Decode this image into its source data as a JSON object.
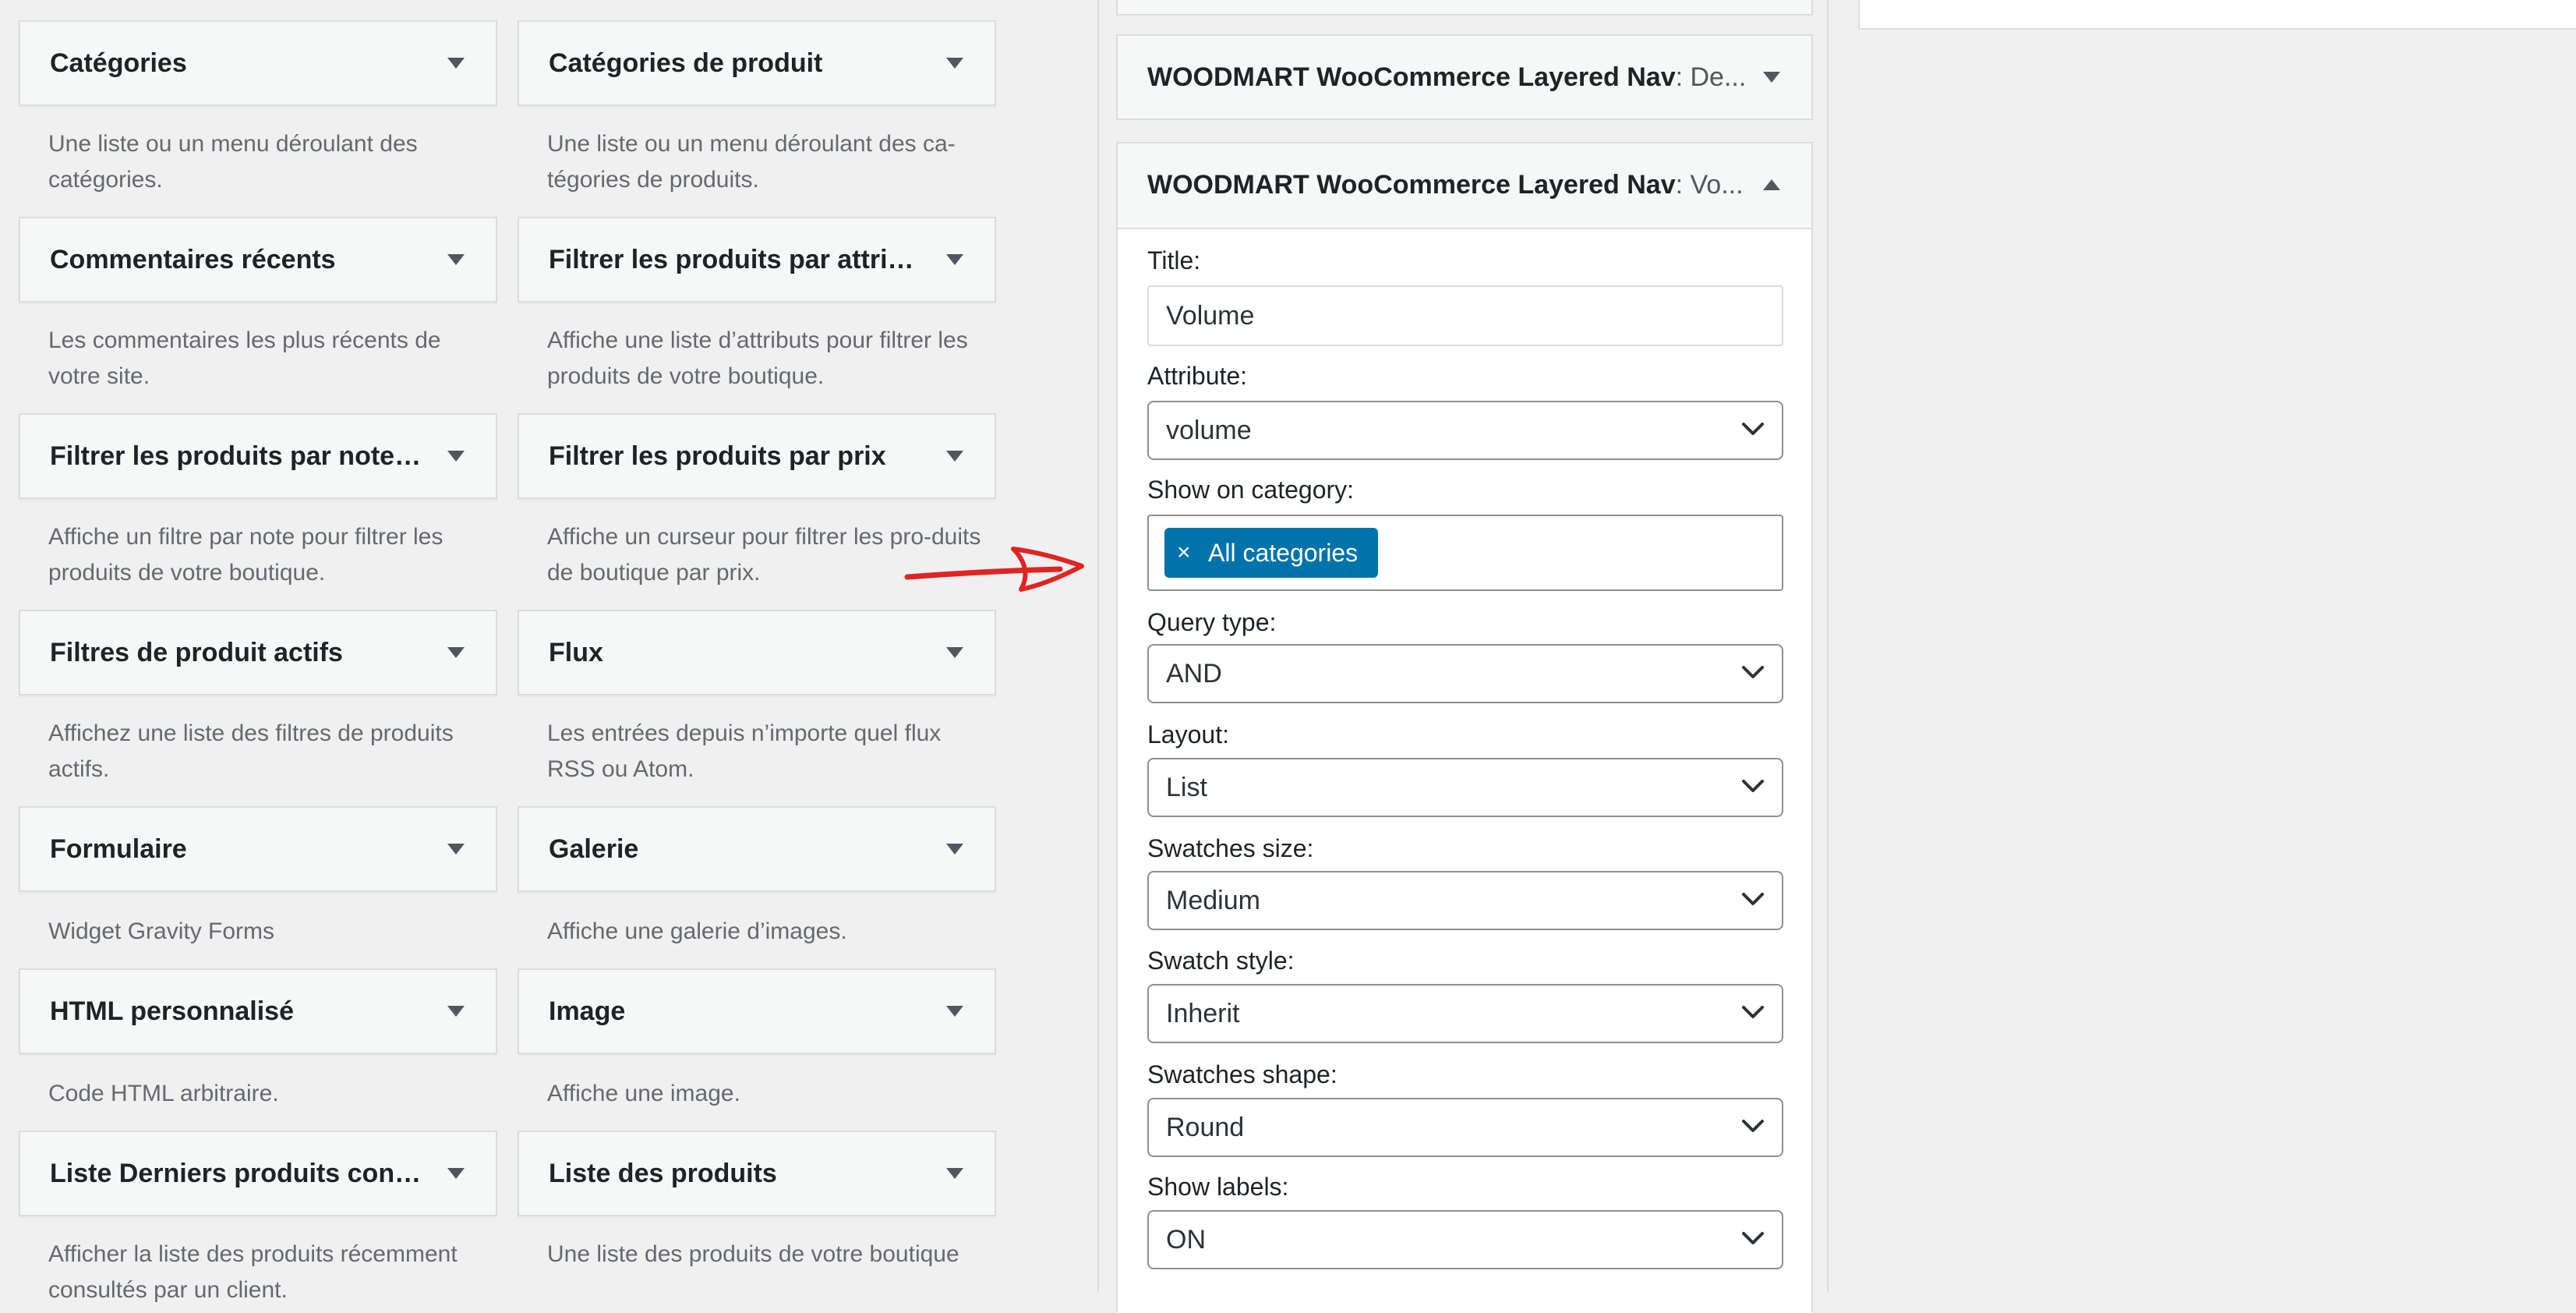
{
  "available_widgets": [
    {
      "title": "Catégories",
      "desc": "Une liste ou un menu déroulant des catégories."
    },
    {
      "title": "Catégories de produit",
      "desc": "Une liste ou un menu déroulant des ca-tégories de produits."
    },
    {
      "title": "Commentaires récents",
      "desc": "Les commentaires les plus récents de votre site."
    },
    {
      "title": "Filtrer les produits par attri…",
      "desc": "Affiche une liste d’attributs pour filtrer les produits de votre boutique."
    },
    {
      "title": "Filtrer les produits par note…",
      "desc": "Affiche un filtre par note pour filtrer les produits de votre boutique."
    },
    {
      "title": "Filtrer les produits par prix",
      "desc": "Affiche un curseur pour filtrer les pro-duits de boutique par prix."
    },
    {
      "title": "Filtres de produit actifs",
      "desc": "Affichez une liste des filtres de produits actifs."
    },
    {
      "title": "Flux",
      "desc": "Les entrées depuis n’importe quel flux RSS ou Atom."
    },
    {
      "title": "Formulaire",
      "desc": "Widget Gravity Forms"
    },
    {
      "title": "Galerie",
      "desc": "Affiche une galerie d’images."
    },
    {
      "title": "HTML personnalisé",
      "desc": "Code HTML arbitraire."
    },
    {
      "title": "Image",
      "desc": "Affiche une image."
    },
    {
      "title": "Liste Derniers produits con…",
      "desc": "Afficher la liste des produits récemment consultés par un client."
    },
    {
      "title": "Liste des produits",
      "desc": "Une liste des produits de votre boutique"
    }
  ],
  "sidebar": {
    "collapsed_widget": {
      "title": "WOODMART WooCommerce Layered Nav",
      "subtitle": ": De..."
    },
    "open_widget": {
      "title": "WOODMART WooCommerce Layered Nav",
      "subtitle": ": Vo...",
      "fields": {
        "title_label": "Title:",
        "title_value": "Volume",
        "attribute_label": "Attribute:",
        "attribute_value": "volume",
        "show_on_category_label": "Show on category:",
        "category_token": "All categories",
        "token_remove": "×",
        "query_type_label": "Query type:",
        "query_type_value": "AND",
        "layout_label": "Layout:",
        "layout_value": "List",
        "swatches_size_label": "Swatches size:",
        "swatches_size_value": "Medium",
        "swatch_style_label": "Swatch style:",
        "swatch_style_value": "Inherit",
        "swatches_shape_label": "Swatches shape:",
        "swatches_shape_value": "Round",
        "show_labels_label": "Show labels:",
        "show_labels_value": "ON"
      }
    }
  },
  "colors": {
    "page_bg": "#f0f0f1",
    "token_bg": "#0073aa",
    "annotation_arrow": "#e02424"
  }
}
